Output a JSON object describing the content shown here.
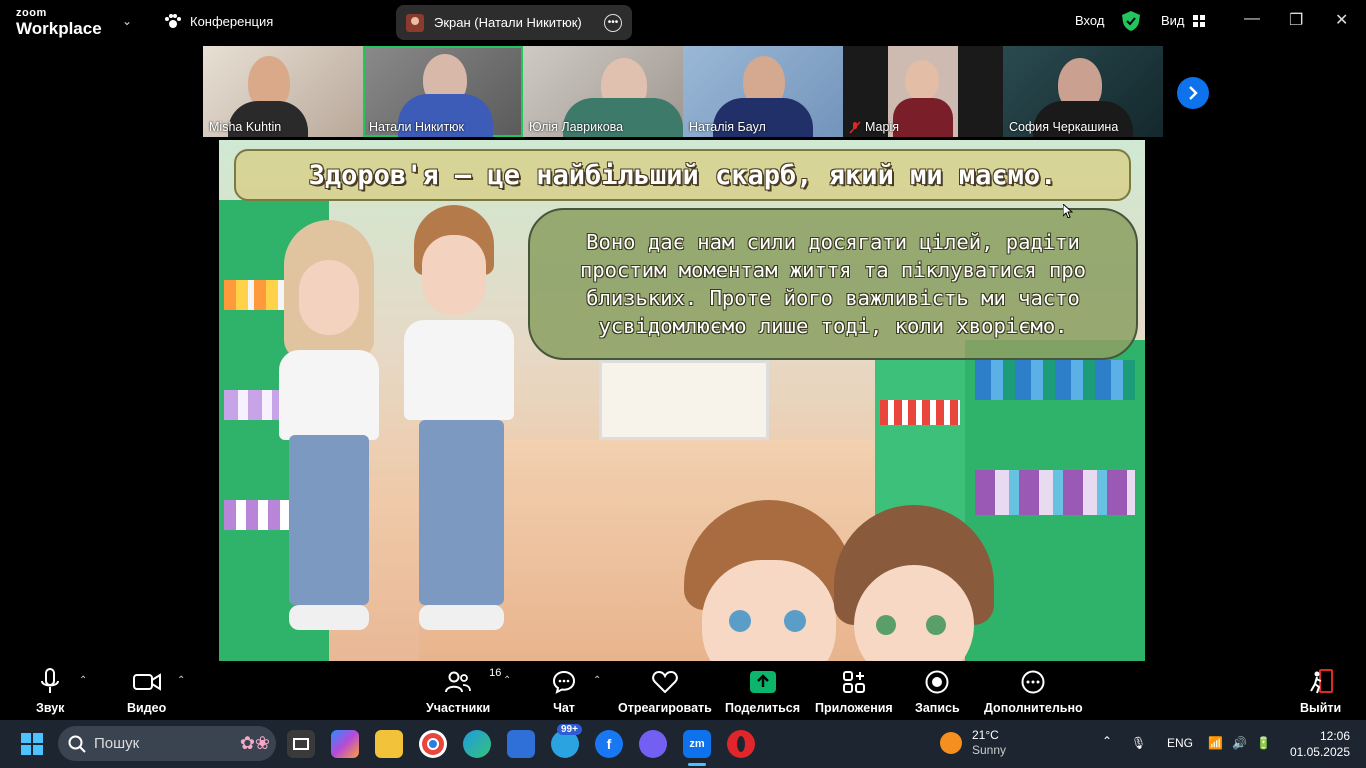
{
  "topbar": {
    "logo_small": "zoom",
    "logo_big": "Workplace",
    "conference_label": "Конференция",
    "share_pill_label": "Экран (Натали Никитюк)",
    "signin_label": "Вход",
    "view_label": "Вид"
  },
  "participants": [
    {
      "name": "Misha Kuhtin",
      "muted": false,
      "active": false
    },
    {
      "name": "Натали Никитюк",
      "muted": false,
      "active": true
    },
    {
      "name": "Юлія Лаврикова",
      "muted": false,
      "active": false
    },
    {
      "name": "Наталія Баул",
      "muted": false,
      "active": false
    },
    {
      "name": "Марія",
      "muted": true,
      "active": false
    },
    {
      "name": "София Черкашина",
      "muted": false,
      "active": false
    }
  ],
  "slide": {
    "title": "Здоров'я — це найбільший скарб, який ми маємо.",
    "body": "Воно дає нам сили досягати цілей, радіти простим моментам життя та піклуватися про близьких. Проте його важливість ми часто усвідомлюємо лише тоді, коли хворіємо."
  },
  "toolbar": {
    "audio": "Звук",
    "video": "Видео",
    "participants": "Участники",
    "participants_count": "16",
    "chat": "Чат",
    "react": "Отреагировать",
    "share": "Поделиться",
    "apps": "Приложения",
    "record": "Запись",
    "more": "Дополнительно",
    "leave": "Выйти"
  },
  "taskbar": {
    "search_placeholder": "Пошук",
    "telegram_badge": "99+",
    "weather_temp": "21°C",
    "weather_desc": "Sunny",
    "lang": "ENG",
    "time": "12:06",
    "date": "01.05.2025"
  },
  "colors": {
    "active_speaker": "#22c55e",
    "share_green": "#0bb56b",
    "zoom_blue": "#0e72ed",
    "leave_red": "#e02828"
  }
}
